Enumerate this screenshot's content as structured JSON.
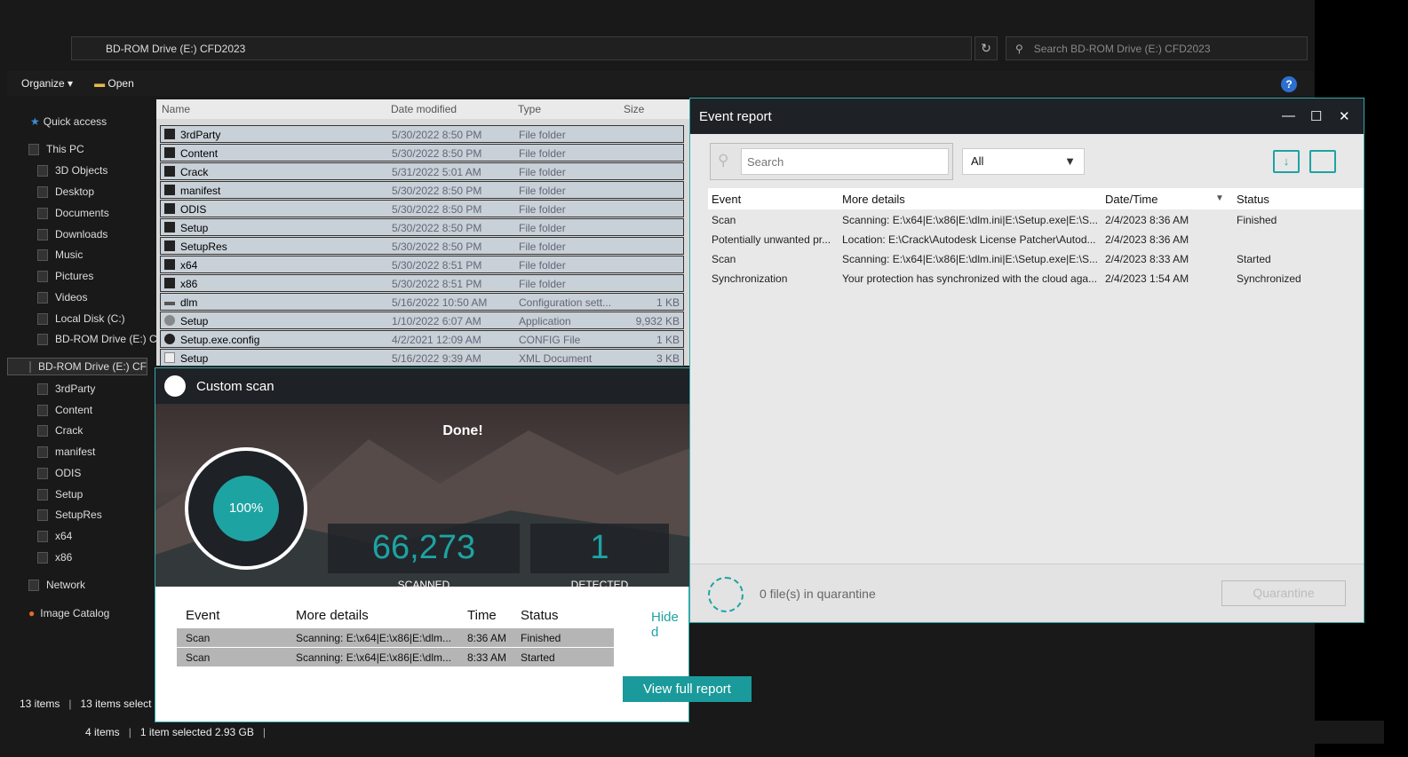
{
  "explorer": {
    "address": "BD-ROM Drive (E:) CFD2023",
    "search_placeholder": "Search BD-ROM Drive (E:) CFD2023",
    "toolbar": {
      "organize": "Organize",
      "open": "Open"
    },
    "nav": [
      "Quick access",
      "This PC",
      "3D Objects",
      "Desktop",
      "Documents",
      "Downloads",
      "Music",
      "Pictures",
      "Videos",
      "Local Disk (C:)",
      "BD-ROM Drive (E:) C",
      "BD-ROM Drive (E:) CF",
      "3rdParty",
      "Content",
      "Crack",
      "manifest",
      "ODIS",
      "Setup",
      "SetupRes",
      "x64",
      "x86",
      "Network",
      "Image Catalog"
    ],
    "columns": [
      "Name",
      "Date modified",
      "Type",
      "Size"
    ],
    "files": [
      {
        "name": "3rdParty",
        "date": "5/30/2022 8:50 PM",
        "type": "File folder",
        "size": ""
      },
      {
        "name": "Content",
        "date": "5/30/2022 8:50 PM",
        "type": "File folder",
        "size": ""
      },
      {
        "name": "Crack",
        "date": "5/31/2022 5:01 AM",
        "type": "File folder",
        "size": ""
      },
      {
        "name": "manifest",
        "date": "5/30/2022 8:50 PM",
        "type": "File folder",
        "size": ""
      },
      {
        "name": "ODIS",
        "date": "5/30/2022 8:50 PM",
        "type": "File folder",
        "size": ""
      },
      {
        "name": "Setup",
        "date": "5/30/2022 8:50 PM",
        "type": "File folder",
        "size": ""
      },
      {
        "name": "SetupRes",
        "date": "5/30/2022 8:50 PM",
        "type": "File folder",
        "size": ""
      },
      {
        "name": "x64",
        "date": "5/30/2022 8:51 PM",
        "type": "File folder",
        "size": ""
      },
      {
        "name": "x86",
        "date": "5/30/2022 8:51 PM",
        "type": "File folder",
        "size": ""
      },
      {
        "name": "dlm",
        "date": "5/16/2022 10:50 AM",
        "type": "Configuration sett...",
        "size": "1 KB"
      },
      {
        "name": "Setup",
        "date": "1/10/2022 6:07 AM",
        "type": "Application",
        "size": "9,932 KB"
      },
      {
        "name": "Setup.exe.config",
        "date": "4/2/2021 12:09 AM",
        "type": "CONFIG File",
        "size": "1 KB"
      },
      {
        "name": "Setup",
        "date": "5/16/2022 9:39 AM",
        "type": "XML Document",
        "size": "3 KB"
      }
    ],
    "status1": {
      "items": "13 items",
      "selected": "13 items select"
    },
    "status2": {
      "items": "4 items",
      "selected": "1 item selected  2.93 GB"
    }
  },
  "scan": {
    "title": "Custom scan",
    "done": "Done!",
    "percent": "100%",
    "scanned_count": "66,273",
    "scanned_label": "SCANNED",
    "detected_count": "1",
    "detected_label": "DETECTED",
    "columns": [
      "Event",
      "More details",
      "Time",
      "Status"
    ],
    "rows": [
      {
        "event": "Scan",
        "details": "Scanning: E:\\x64|E:\\x86|E:\\dlm...",
        "time": "8:36 AM",
        "status": "Finished"
      },
      {
        "event": "Scan",
        "details": "Scanning: E:\\x64|E:\\x86|E:\\dlm...",
        "time": "8:33 AM",
        "status": "Started"
      }
    ],
    "hide_link": "Hide d",
    "view_full_report": "View full report"
  },
  "event_report": {
    "title": "Event report",
    "search_placeholder": "Search",
    "filter": "All",
    "columns": [
      "Event",
      "More details",
      "Date/Time",
      "Status"
    ],
    "rows": [
      {
        "event": "Scan",
        "details": "Scanning: E:\\x64|E:\\x86|E:\\dlm.ini|E:\\Setup.exe|E:\\S...",
        "datetime": "2/4/2023 8:36 AM",
        "status": "Finished"
      },
      {
        "event": "Potentially unwanted pr...",
        "details": "Location: E:\\Crack\\Autodesk License Patcher\\Autod...",
        "datetime": "2/4/2023 8:36 AM",
        "status": ""
      },
      {
        "event": "Scan",
        "details": "Scanning: E:\\x64|E:\\x86|E:\\dlm.ini|E:\\Setup.exe|E:\\S...",
        "datetime": "2/4/2023 8:33 AM",
        "status": "Started"
      },
      {
        "event": "Synchronization",
        "details": "Your protection has synchronized with the cloud aga...",
        "datetime": "2/4/2023 1:54 AM",
        "status": "Synchronized"
      }
    ],
    "quarantine_text": "0 file(s) in quarantine",
    "quarantine_button": "Quarantine"
  },
  "colors": {
    "accent": "#1ea3a3",
    "titlebar": "#1e2126"
  }
}
